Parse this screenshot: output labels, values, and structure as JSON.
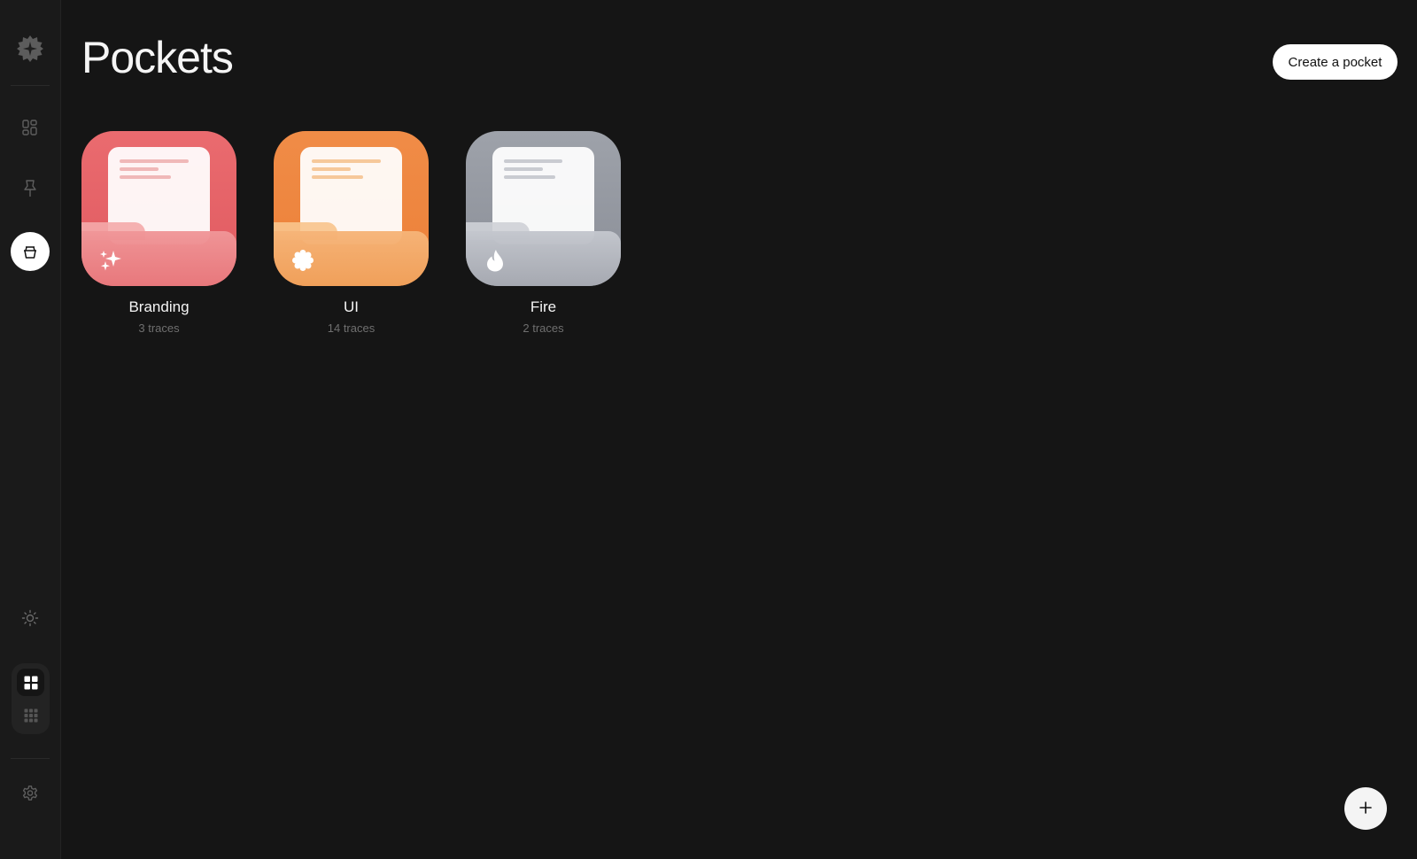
{
  "header": {
    "title": "Pockets",
    "create_label": "Create a pocket"
  },
  "sidebar": {
    "logo_icon": "flower-badge-icon",
    "items": [
      {
        "name": "cards",
        "icon": "grid-cards-icon"
      },
      {
        "name": "pinned",
        "icon": "pin-icon"
      },
      {
        "name": "pockets",
        "icon": "pot-icon",
        "active": true
      },
      {
        "name": "theme",
        "icon": "sun-icon"
      },
      {
        "name": "settings",
        "icon": "gear-icon"
      }
    ],
    "view_toggle": {
      "selected": "grid",
      "options": [
        "grid",
        "dense-grid"
      ]
    }
  },
  "pockets": [
    {
      "name": "Branding",
      "count": "3 traces",
      "icon": "sparkles-icon",
      "color": "#e8676c"
    },
    {
      "name": "UI",
      "count": "14 traces",
      "icon": "flower-icon",
      "color": "#ef8a42"
    },
    {
      "name": "Fire",
      "count": "2 traces",
      "icon": "flame-icon",
      "color": "#979aa3"
    }
  ],
  "fab": {
    "icon": "plus-icon"
  }
}
